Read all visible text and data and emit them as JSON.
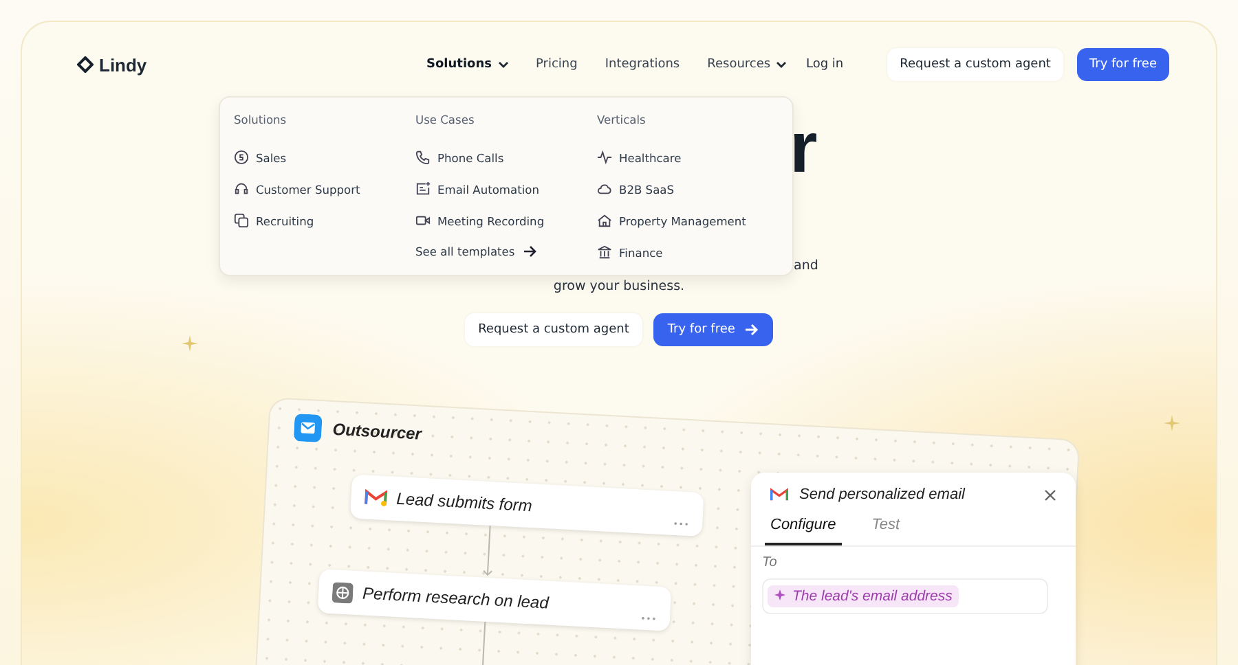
{
  "nav": {
    "logo": "Lindy",
    "links": [
      {
        "label": "Solutions",
        "dropdown": true,
        "selected": true
      },
      {
        "label": "Pricing",
        "dropdown": false,
        "selected": false
      },
      {
        "label": "Integrations",
        "dropdown": false,
        "selected": false
      },
      {
        "label": "Resources",
        "dropdown": true,
        "selected": false
      }
    ],
    "login": "Log in",
    "secondary_button": "Request a custom agent",
    "primary_button": "Try for free"
  },
  "menu": {
    "columns": [
      {
        "heading": "Solutions",
        "items": [
          {
            "label": "Sales",
            "kind": "dollar"
          },
          {
            "label": "Customer Support",
            "kind": "headset"
          },
          {
            "label": "Recruiting",
            "kind": "people"
          }
        ]
      },
      {
        "heading": "Use Cases",
        "items": [
          {
            "label": "Phone Calls",
            "kind": "phone"
          },
          {
            "label": "Email Automation",
            "kind": "mail"
          },
          {
            "label": "Meeting Recording",
            "kind": "video"
          }
        ],
        "link": "See all templates"
      },
      {
        "heading": "Verticals",
        "items": [
          {
            "label": "Healthcare",
            "kind": "pulse"
          },
          {
            "label": "B2B SaaS",
            "kind": "cloud"
          },
          {
            "label": "Property Management",
            "kind": "house"
          },
          {
            "label": "Finance",
            "kind": "bank"
          }
        ]
      }
    ]
  },
  "hero": {
    "heading_fragment": "r",
    "subtitle_end": "and",
    "subtitle": "grow your business.",
    "secondary_button": "Request a custom agent",
    "primary_button": "Try for free"
  },
  "workflow": {
    "title": "Outsourcer",
    "steps": [
      {
        "label": "Lead submits form",
        "kind": "gmail"
      },
      {
        "label": "Perform research on lead",
        "kind": "globe"
      }
    ],
    "panel": {
      "title": "Send personalized email",
      "tabs": [
        {
          "label": "Configure",
          "selected": true
        },
        {
          "label": "Test",
          "selected": false
        }
      ],
      "field_label": "To",
      "chip": "The lead's email address"
    }
  }
}
